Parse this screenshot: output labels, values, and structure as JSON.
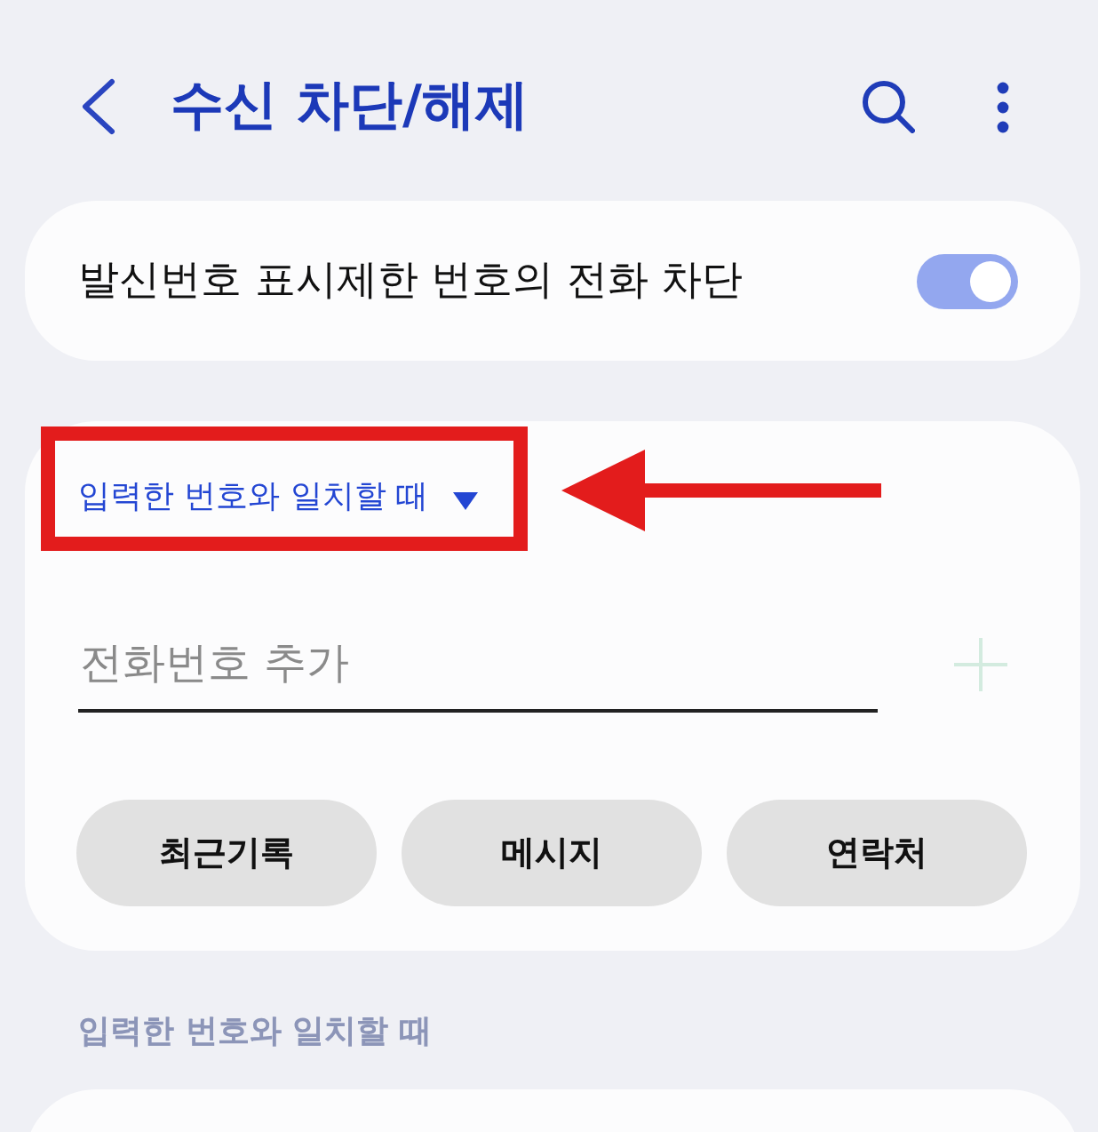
{
  "header": {
    "title": "수신 차단/해제"
  },
  "toggle_row": {
    "label": "발신번호 표시제한 번호의 전화 차단",
    "on": true
  },
  "block_card": {
    "match_dropdown": {
      "label": "입력한 번호와 일치할 때"
    },
    "phone_field": {
      "placeholder": "전화번호 추가"
    },
    "add_button": {
      "disabled": true
    },
    "source_buttons": [
      "최근기록",
      "메시지",
      "연락처"
    ]
  },
  "section_header": "입력한 번호와 일치할 때"
}
